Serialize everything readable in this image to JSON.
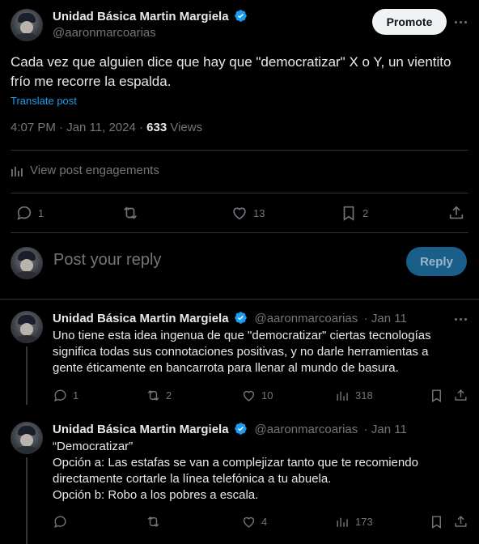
{
  "main_post": {
    "author_name": "Unidad Básica Martin Margiela",
    "author_handle": "@aaronmarcoarias",
    "promote_label": "Promote",
    "text_line1": "Cada vez que alguien dice que hay que \"democratizar\" X o Y, un vientito",
    "text_line2": "frío me recorre la espalda.",
    "translate_label": "Translate post",
    "timestamp": "4:07 PM · Jan 11, 2024 · ",
    "views_count": "633",
    "views_label": " Views",
    "engagements_label": "View post engagements",
    "replies": "1",
    "reposts": "",
    "likes": "13",
    "bookmarks": "2"
  },
  "composer": {
    "placeholder": "Post your reply",
    "reply_label": "Reply"
  },
  "replies": [
    {
      "author_name": "Unidad Básica Martin Margiela",
      "author_handle": "@aaronmarcoarias",
      "date": "· Jan 11",
      "lines": [
        "Uno tiene esta idea ingenua de que \"democratizar\" ciertas tecnologías",
        "significa todas sus connotaciones positivas, y no darle herramientas a",
        "gente éticamente en bancarrota para llenar al mundo de basura."
      ],
      "replies": "1",
      "reposts": "2",
      "likes": "10",
      "views": "318"
    },
    {
      "author_name": "Unidad Básica Martin Margiela",
      "author_handle": "@aaronmarcoarias",
      "date": "· Jan 11",
      "lines": [
        "“Democratizar”",
        "Opción a: Las estafas se van a complejizar tanto que te recomiendo",
        "directamente cortarle la línea telefónica a tu abuela.",
        "Opción b: Robo a los pobres a escala."
      ],
      "replies": "",
      "reposts": "",
      "likes": "4",
      "views": "173"
    }
  ],
  "colors": {
    "background": "#000000",
    "text": "#e7e9ea",
    "muted": "#71767b",
    "accent": "#1d9bf0",
    "divider": "#2f3336"
  },
  "icons": [
    "verified-badge-icon",
    "more-icon",
    "reply-icon",
    "repost-icon",
    "like-icon",
    "bookmark-icon",
    "share-icon",
    "analytics-icon"
  ]
}
